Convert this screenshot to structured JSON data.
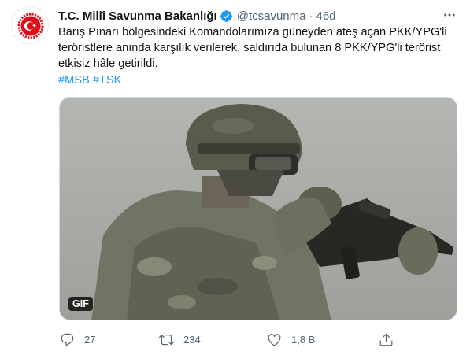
{
  "account": {
    "name": "T.C. Millî Savunma Bakanlığı",
    "handle": "@tcsavunma",
    "separator": "·",
    "time": "46d",
    "avatar_icon": "ministry-crescent-emblem",
    "verified_icon": "verified-badge-icon",
    "verified_color": "#1d9bf0"
  },
  "tweet": {
    "text_lines": [
      "Barış Pınarı bölgesindeki Komandolarımıza güneyden ateş açan PKK/YPG'li",
      "teröristlere anında karşılık verilerek, saldırıda bulunan 8 PKK/YPG'li terörist",
      "etkisiz hâle getirildi."
    ],
    "hashtags": [
      "#MSB",
      "#TSK"
    ],
    "hashtag_color": "#1d9bf0"
  },
  "media": {
    "type": "gif",
    "badge": "GIF",
    "description_icon": "soldier-with-rifle-gif"
  },
  "actions": {
    "reply": {
      "icon": "reply-icon",
      "count": "27"
    },
    "retweet": {
      "icon": "retweet-icon",
      "count": "234"
    },
    "like": {
      "icon": "heart-icon",
      "count": "1,8 B"
    },
    "share": {
      "icon": "share-icon"
    }
  },
  "more_icon": "more-options-icon",
  "text_secondary_color": "#536471"
}
